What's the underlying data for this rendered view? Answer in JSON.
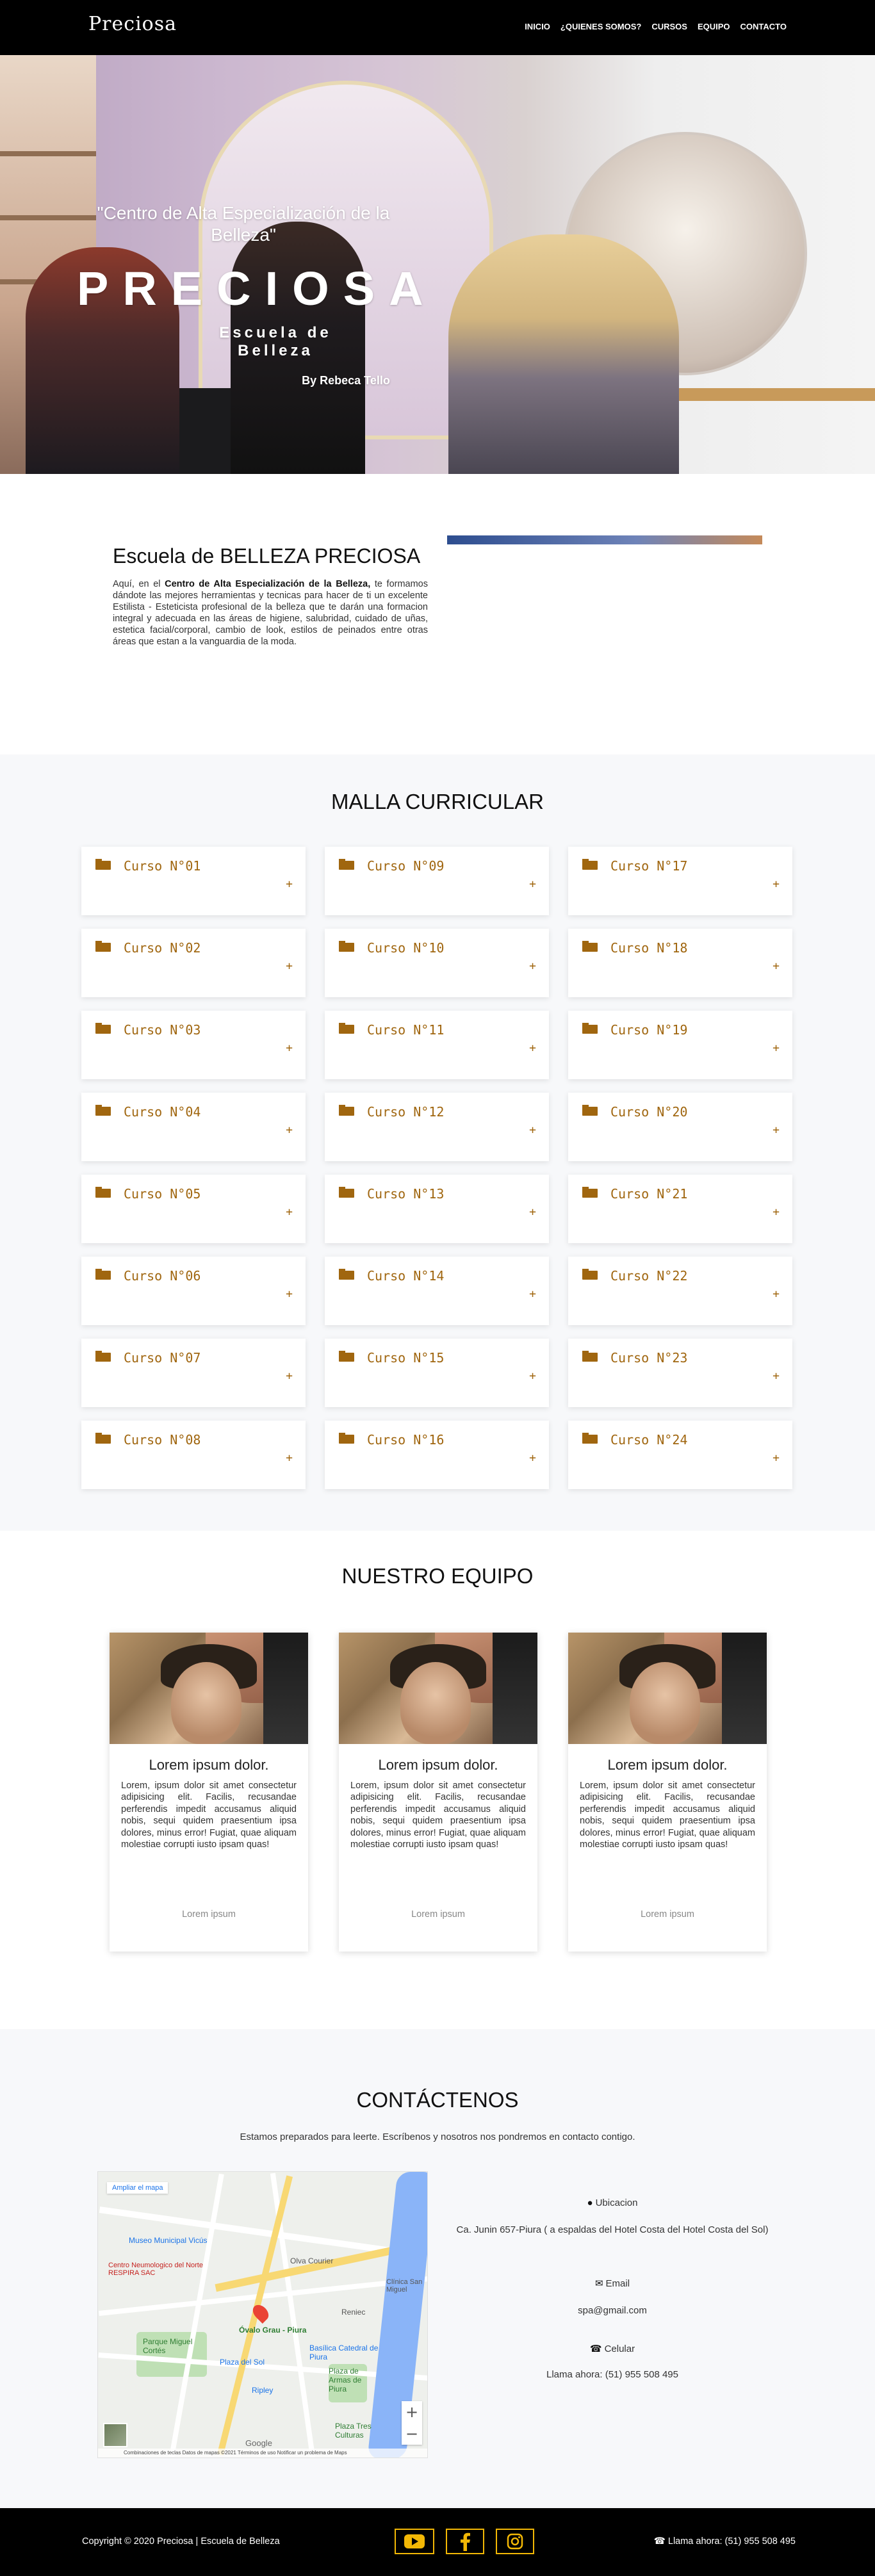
{
  "brand": {
    "logo": "Preciosa",
    "accent": "#a0660f",
    "social_accent": "#f2b705"
  },
  "nav": {
    "items": [
      "INICIO",
      "¿QUIENES SOMOS?",
      "CURSOS",
      "EQUIPO",
      "CONTACTO"
    ]
  },
  "hero": {
    "quote_line1": "\"Centro de Alta Especialización de la",
    "quote_line2": "Belleza\"",
    "title": "PRECIOSA",
    "subtitle": "Escuela de Belleza",
    "byline": "By Rebeca Tello"
  },
  "about": {
    "title": "Escuela de BELLEZA PRECIOSA",
    "text_before": "Aquí, en el ",
    "text_bold": "Centro de Alta Especialización de la Belleza,",
    "text_after": " te formamos dándote las mejores herramientas y tecnicas para hacer de ti un excelente Estilista - Esteticista profesional de la belleza que te darán una formacion integral y adecuada en las áreas de higiene, salubridad, cuidado de uñas, estetica facial/corporal, cambio de look, estilos de peinados entre otras áreas que estan a la vanguardia de la moda."
  },
  "malla": {
    "title": "MALLA CURRICULAR",
    "expand_symbol": "+",
    "columns": [
      [
        "Curso N°01",
        "Curso N°02",
        "Curso N°03",
        "Curso N°04",
        "Curso N°05",
        "Curso N°06",
        "Curso N°07",
        "Curso N°08"
      ],
      [
        "Curso N°09",
        "Curso N°10",
        "Curso N°11",
        "Curso N°12",
        "Curso N°13",
        "Curso N°14",
        "Curso N°15",
        "Curso N°16"
      ],
      [
        "Curso N°17",
        "Curso N°18",
        "Curso N°19",
        "Curso N°20",
        "Curso N°21",
        "Curso N°22",
        "Curso N°23",
        "Curso N°24"
      ]
    ]
  },
  "team": {
    "title": "NUESTRO EQUIPO",
    "members": [
      {
        "name": "Lorem ipsum dolor.",
        "text": "Lorem, ipsum dolor sit amet consectetur adipisicing elit. Facilis, recusandae perferendis impedit accusamus aliquid nobis, sequi quidem praesentium ipsa dolores, minus error! Fugiat, quae aliquam molestiae corrupti iusto ipsam quas!",
        "footer": "Lorem ipsum"
      },
      {
        "name": "Lorem ipsum dolor.",
        "text": "Lorem, ipsum dolor sit amet consectetur adipisicing elit. Facilis, recusandae perferendis impedit accusamus aliquid nobis, sequi quidem praesentium ipsa dolores, minus error! Fugiat, quae aliquam molestiae corrupti iusto ipsam quas!",
        "footer": "Lorem ipsum"
      },
      {
        "name": "Lorem ipsum dolor.",
        "text": "Lorem, ipsum dolor sit amet consectetur adipisicing elit. Facilis, recusandae perferendis impedit accusamus aliquid nobis, sequi quidem praesentium ipsa dolores, minus error! Fugiat, quae aliquam molestiae corrupti iusto ipsam quas!",
        "footer": "Lorem ipsum"
      }
    ]
  },
  "contact": {
    "title": "CONTÁCTENOS",
    "subtitle": "Estamos preparados para leerte. Escríbenos y nosotros nos pondremos en contacto contigo.",
    "map": {
      "expand_label": "Ampliar el mapa",
      "labels": [
        "Museo Municipal Vicús",
        "Centro Neumologico del Norte RESPIRA SAC",
        "Olva Courier",
        "Clínica San Miguel",
        "Reniec",
        "Parque Miguel Cortés",
        "Óvalo Grau - Piura",
        "Basílica Catedral de Piura",
        "Plaza del Sol",
        "Plaza de Armas de Piura",
        "Ripley",
        "Plaza Tres Culturas"
      ],
      "google": "Google",
      "attribution": "Combinaciones de teclas   Datos de mapas ©2021   Términos de uso   Notificar un problema de Maps",
      "zoom_in": "+",
      "zoom_out": "−"
    },
    "location_label": "Ubicacion",
    "location_value": "Ca. Junin 657-Piura ( a espaldas del Hotel Costa del Hotel Costa del Sol)",
    "email_label": "Email",
    "email_value": "spa@gmail.com",
    "phone_label": "Celular",
    "phone_value": "Llama ahora: (51) 955 508 495"
  },
  "footer": {
    "copyright": "Copyright © 2020 Preciosa | Escuela de Belleza",
    "socials": [
      "youtube-icon",
      "facebook-icon",
      "instagram-icon"
    ],
    "phone": "Llama ahora: (51) 955 508 495"
  }
}
